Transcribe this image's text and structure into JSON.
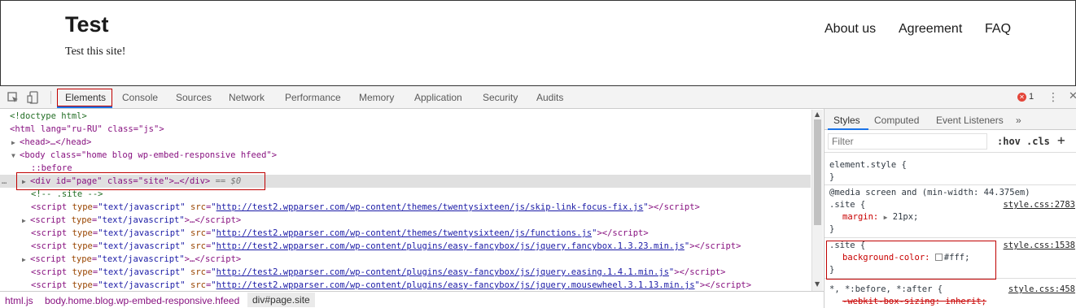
{
  "site": {
    "title": "Test",
    "description": "Test this site!",
    "nav": [
      "About us",
      "Agreement",
      "FAQ"
    ]
  },
  "devtools": {
    "tabs": [
      "Elements",
      "Console",
      "Sources",
      "Network",
      "Performance",
      "Memory",
      "Application",
      "Security",
      "Audits"
    ],
    "error_count": "1",
    "dom": {
      "doctype": "<!doctype html>",
      "html_open": "<html lang=\"ru-RU\" class=\"js\">",
      "head": "<head>…</head>",
      "body_open": "<body class=\"home blog wp-embed-responsive hfeed\">",
      "before": "::before",
      "div_page": "<div id=\"page\" class=\"site\">…</div>",
      "dollar": "== $0",
      "comment": "<!-- .site -->",
      "scripts": [
        {
          "src": "http://test2.wpparser.com/wp-content/themes/twentysixteen/js/skip-link-focus-fix.js",
          "collapsed": false
        },
        {
          "src": "",
          "collapsed": true
        },
        {
          "src": "http://test2.wpparser.com/wp-content/themes/twentysixteen/js/functions.js",
          "collapsed": false
        },
        {
          "src": "http://test2.wpparser.com/wp-content/plugins/easy-fancybox/js/jquery.fancybox.1.3.23.min.js",
          "collapsed": false
        },
        {
          "src": "",
          "collapsed": true
        },
        {
          "src": "http://test2.wpparser.com/wp-content/plugins/easy-fancybox/js/jquery.easing.1.4.1.min.js",
          "collapsed": false
        },
        {
          "src": "http://test2.wpparser.com/wp-content/plugins/easy-fancybox/js/jquery.mousewheel.3.1.13.min.js",
          "collapsed": false
        }
      ]
    },
    "breadcrumbs": [
      "html.js",
      "body.home.blog.wp-embed-responsive.hfeed",
      "div#page.site"
    ],
    "styles_tabs": [
      "Styles",
      "Computed",
      "Event Listeners",
      "»"
    ],
    "filter_placeholder": "Filter",
    "hov": ":hov",
    "cls": ".cls",
    "rules": {
      "element_style": "element.style {",
      "close": "}",
      "media": "@media screen and (min-width: 44.375em)",
      "site_selector": ".site {",
      "margin_name": "margin:",
      "margin_value": "21px;",
      "src1": "style.css:2783",
      "bg_name": "background-color:",
      "bg_value": "#fff;",
      "src2": "style.css:1538",
      "universal": "*, *:before, *:after {",
      "src3": "style.css:458",
      "webkit": "-webkit-box-sizing: inherit;"
    }
  }
}
